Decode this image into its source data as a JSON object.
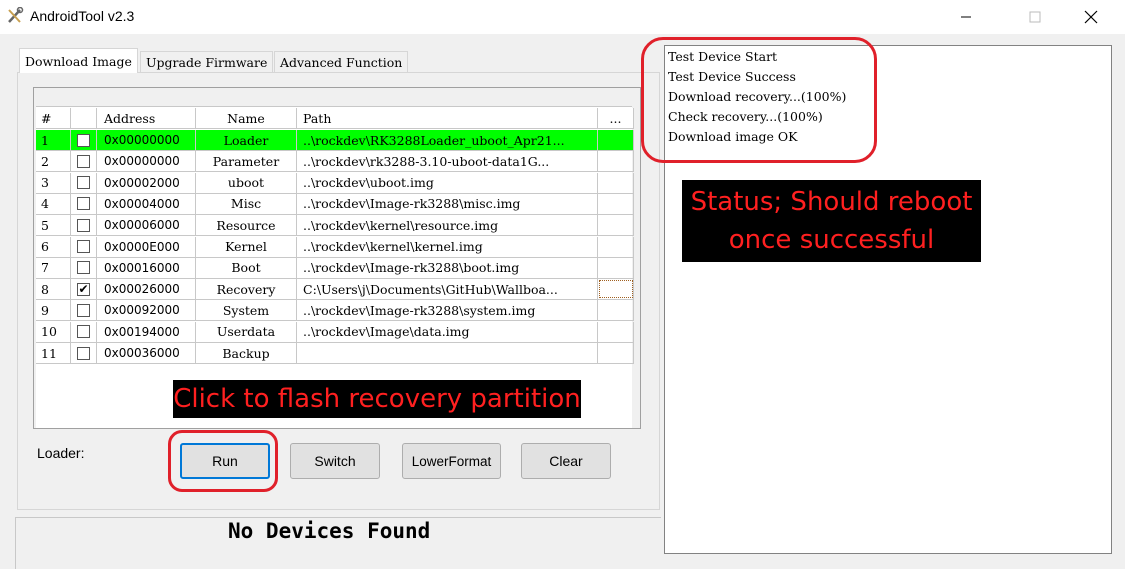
{
  "window": {
    "title": "AndroidTool v2.3",
    "icon": "tools-icon",
    "controls": [
      "minimize-icon",
      "maximize-icon",
      "close-icon"
    ]
  },
  "tabs": [
    {
      "label": "Download Image",
      "active": true
    },
    {
      "label": "Upgrade Firmware",
      "active": false
    },
    {
      "label": "Advanced Function",
      "active": false
    }
  ],
  "table": {
    "headers": {
      "num": "#",
      "address": "Address",
      "name": "Name",
      "path": "Path",
      "extra": "..."
    },
    "rows": [
      {
        "num": "1",
        "checked": false,
        "address": "0x00000000",
        "name": "Loader",
        "path": "..\\rockdev\\RK3288Loader_uboot_Apr21...",
        "highlight": true
      },
      {
        "num": "2",
        "checked": false,
        "address": "0x00000000",
        "name": "Parameter",
        "path": "..\\rockdev\\rk3288-3.10-uboot-data1G..."
      },
      {
        "num": "3",
        "checked": false,
        "address": "0x00002000",
        "name": "uboot",
        "path": "..\\rockdev\\uboot.img"
      },
      {
        "num": "4",
        "checked": false,
        "address": "0x00004000",
        "name": "Misc",
        "path": "..\\rockdev\\Image-rk3288\\misc.img"
      },
      {
        "num": "5",
        "checked": false,
        "address": "0x00006000",
        "name": "Resource",
        "path": "..\\rockdev\\kernel\\resource.img"
      },
      {
        "num": "6",
        "checked": false,
        "address": "0x0000E000",
        "name": "Kernel",
        "path": "..\\rockdev\\kernel\\kernel.img"
      },
      {
        "num": "7",
        "checked": false,
        "address": "0x00016000",
        "name": "Boot",
        "path": "..\\rockdev\\Image-rk3288\\boot.img"
      },
      {
        "num": "8",
        "checked": true,
        "address": "0x00026000",
        "name": "Recovery",
        "path": "C:\\Users\\j\\Documents\\GitHub\\Wallboa..."
      },
      {
        "num": "9",
        "checked": false,
        "address": "0x00092000",
        "name": "System",
        "path": "..\\rockdev\\Image-rk3288\\system.img"
      },
      {
        "num": "10",
        "checked": false,
        "address": "0x00194000",
        "name": "Userdata",
        "path": "..\\rockdev\\Image\\data.img"
      },
      {
        "num": "11",
        "checked": false,
        "address": "0x00036000",
        "name": "Backup",
        "path": ""
      }
    ],
    "checkmark": "✔"
  },
  "loader_label": "Loader:",
  "buttons": {
    "run": "Run",
    "switch": "Switch",
    "lowerformat": "LowerFormat",
    "clear": "Clear"
  },
  "status": "No Devices Found",
  "log": [
    "Test Device Start",
    "Test Device Success",
    "Download recovery...(100%)",
    "Check recovery...(100%)",
    "Download image OK"
  ],
  "annotations": {
    "flash_hint": "Click to flash recovery partition",
    "status_hint_line1": "Status; Should reboot",
    "status_hint_line2": "once successful",
    "color": "#ff2020"
  }
}
